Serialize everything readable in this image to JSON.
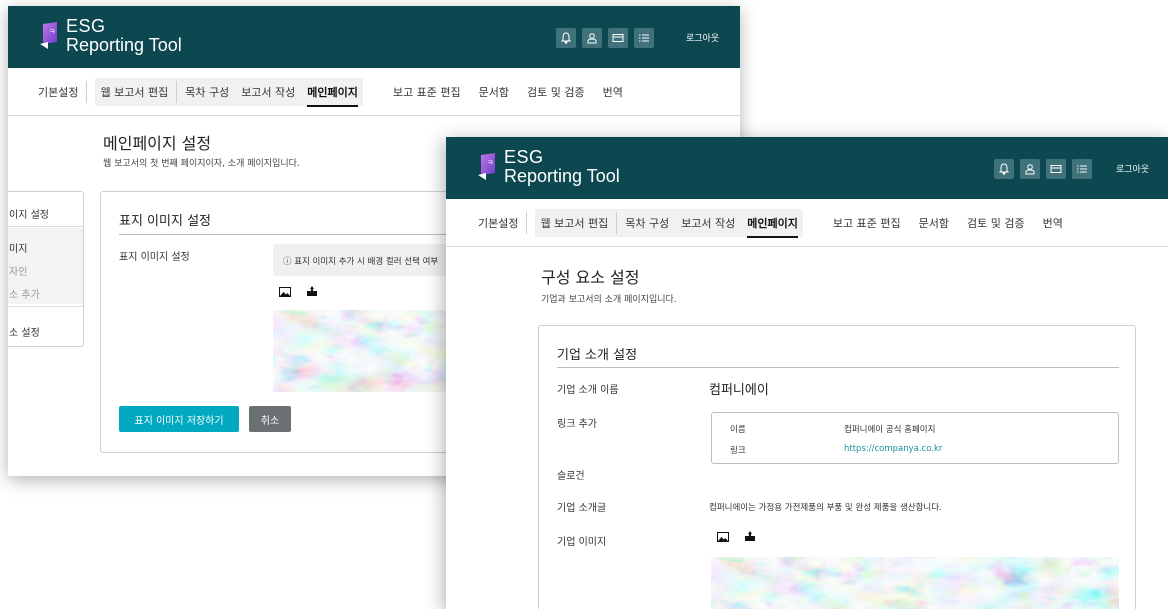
{
  "app": {
    "logo_line1": "ESG",
    "logo_line2": "Reporting Tool",
    "logout": "로그아웃"
  },
  "nav": {
    "basic": "기본설정",
    "web_edit": "웹 보고서 편집",
    "toc": "목차 구성",
    "write": "보고서 작성",
    "main": "메인페이지",
    "standard": "보고 표준 편집",
    "docs": "문서함",
    "review": "검토 및 검증",
    "translate": "번역"
  },
  "back": {
    "title": "메인페이지 설정",
    "subtitle": "웹 보고서의 첫 번째 페이지이자, 소개 페이지입니다.",
    "sidebar": {
      "item1": "이지 설정",
      "item2": "미지",
      "item3": "자인",
      "item4": "소 추가",
      "item5": "소 설정"
    },
    "panel_title": "표지 이미지 설정",
    "label": "표지 이미지 설정",
    "notice": "ⓘ 표지 이미지 추가 시 배경 컬러 선택 여부",
    "save_button": "표지 이미지 저장하기",
    "cancel_button": "취소"
  },
  "front": {
    "title": "구성 요소 설정",
    "subtitle": "기업과 보고서의 소개 페이지입니다.",
    "panel_title": "기업 소개 설정",
    "company_name_label": "기업 소개 이름",
    "company_name_value": "컴퍼니에이",
    "link_label": "링크 추가",
    "link_name_key": "이름",
    "link_name_value": "컴퍼니에이 공식 홈페이지",
    "link_url_key": "링크",
    "link_url_value": "https://companya.co.kr",
    "slogan_label": "슬로건",
    "intro_label": "기업 소개글",
    "intro_value": "컴퍼니에이는 가정용 가전제품의 부품 및 완성 제품을 생산합니다.",
    "image_label": "기업 이미지"
  },
  "colors": {
    "header": "#0d4750",
    "accent": "#00a8c0",
    "cancel": "#6b7073",
    "link": "#1a8fa0"
  }
}
